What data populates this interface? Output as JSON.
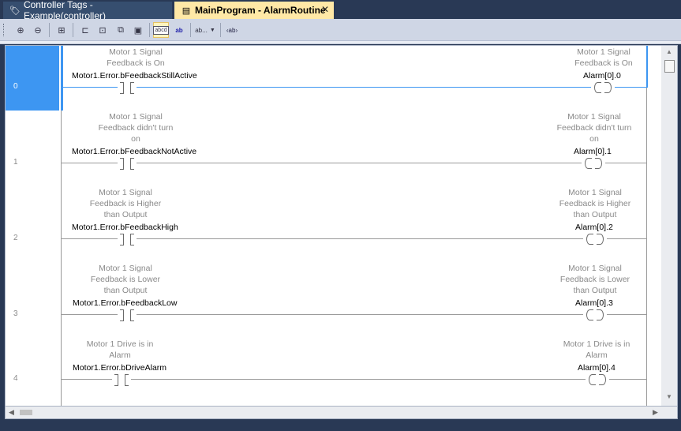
{
  "tabs": [
    {
      "label": "Controller Tags - Example(controller)",
      "icon": "tag-icon",
      "active": false
    },
    {
      "label": "MainProgram - AlarmRoutine",
      "icon": "routine-icon",
      "active": true,
      "close": "✕"
    }
  ],
  "toolbar": {
    "zoom_in": "⊕",
    "zoom_out": "⊖",
    "abcd_label": "abcd",
    "ab_label": "ab",
    "ab_dropdown_label": "ab...",
    "ab_tag_label": "‹ab›"
  },
  "rungs": [
    {
      "number": "0",
      "contact_desc": [
        "Motor 1 Signal",
        "Feedback is On"
      ],
      "contact_tag": "Motor1.Error.bFeedbackStillActive",
      "coil_desc": [
        "Motor 1 Signal",
        "Feedback is On"
      ],
      "coil_tag": "Alarm[0].0",
      "selected": true
    },
    {
      "number": "1",
      "contact_desc": [
        "Motor 1 Signal",
        "Feedback didn't turn",
        "on"
      ],
      "contact_tag": "Motor1.Error.bFeedbackNotActive",
      "coil_desc": [
        "Motor 1 Signal",
        "Feedback didn't turn",
        "on"
      ],
      "coil_tag": "Alarm[0].1",
      "selected": false
    },
    {
      "number": "2",
      "contact_desc": [
        "Motor 1 Signal",
        "Feedback is Higher",
        "than Output"
      ],
      "contact_tag": "Motor1.Error.bFeedbackHigh",
      "coil_desc": [
        "Motor 1 Signal",
        "Feedback is Higher",
        "than Output"
      ],
      "coil_tag": "Alarm[0].2",
      "selected": false
    },
    {
      "number": "3",
      "contact_desc": [
        "Motor 1 Signal",
        "Feedback is Lower",
        "than Output"
      ],
      "contact_tag": "Motor1.Error.bFeedbackLow",
      "coil_desc": [
        "Motor 1 Signal",
        "Feedback is Lower",
        "than Output"
      ],
      "coil_tag": "Alarm[0].3",
      "selected": false
    },
    {
      "number": "4",
      "contact_desc": [
        "Motor 1 Drive is in",
        "Alarm"
      ],
      "contact_tag": "Motor1.Error.bDriveAlarm",
      "coil_desc": [
        "Motor 1 Drive is in",
        "Alarm"
      ],
      "coil_tag": "Alarm[0].4",
      "selected": false
    }
  ],
  "colors": {
    "selection": "#3d96f2",
    "active_tab": "#ffe8a6",
    "frame": "#293955"
  }
}
